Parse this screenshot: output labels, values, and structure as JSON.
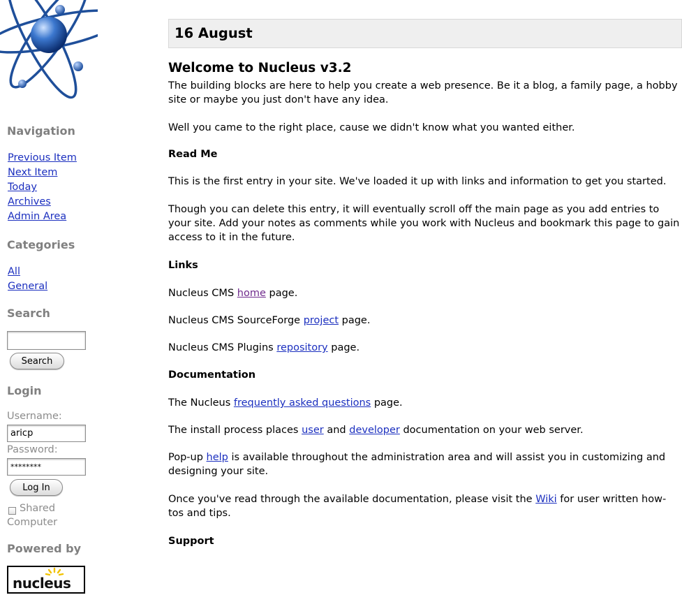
{
  "sidebar": {
    "navigation_heading": "Navigation",
    "nav_links": [
      "Previous Item",
      "Next Item",
      "Today",
      "Archives",
      "Admin Area"
    ],
    "categories_heading": "Categories",
    "category_links": [
      "All",
      "General"
    ],
    "search_heading": "Search",
    "search_value": "",
    "search_button": "Search",
    "login_heading": "Login",
    "username_label": "Username:",
    "username_value": "aricp",
    "password_label": "Password:",
    "password_value": "********",
    "login_button": "Log In",
    "shared_label_1": "Shared",
    "shared_label_2": "Computer",
    "powered_heading": "Powered by",
    "powered_logo_text": "nucleus"
  },
  "main": {
    "date": "16 August",
    "title": "Welcome to Nucleus v3.2",
    "intro": "The building blocks are here to help you create a web presence. Be it a blog, a family page, a hobby site or maybe you just don't have any idea.",
    "intro2": "Well you came to the right place, cause we didn't know what you wanted either.",
    "readme_heading": "Read Me",
    "readme_p1": "This is the first entry in your site. We've loaded it up with links and information to get you started.",
    "readme_p2": "Though you can delete this entry, it will eventually scroll off the main page as you add entries to your site. Add your notes as comments while you work with Nucleus and bookmark this page to gain access to it in the future.",
    "links_heading": "Links",
    "link1_pre": "Nucleus CMS ",
    "link1_a": "home",
    "link1_post": " page.",
    "link2_pre": "Nucleus CMS SourceForge ",
    "link2_a": "project",
    "link2_post": " page.",
    "link3_pre": "Nucleus CMS Plugins ",
    "link3_a": "repository",
    "link3_post": " page.",
    "docs_heading": "Documentation",
    "doc1_pre": "The Nucleus ",
    "doc1_a": "frequently asked questions",
    "doc1_post": " page.",
    "doc2_pre": "The install process places ",
    "doc2_a1": "user",
    "doc2_mid": " and ",
    "doc2_a2": "developer",
    "doc2_post": " documentation on your web server.",
    "doc3_pre": "Pop-up ",
    "doc3_a": "help",
    "doc3_post": " is available throughout the administration area and will assist you in customizing and designing your site.",
    "doc4_pre": "Once you've read through the available documentation, please visit the ",
    "doc4_a": "Wiki",
    "doc4_post": " for user written how-tos and tips.",
    "support_heading": "Support"
  },
  "colors": {
    "link": "#1b2fbf",
    "visited_link": "#6f2a8c",
    "sidebar_heading": "#808080",
    "date_bar": "#efefef"
  }
}
